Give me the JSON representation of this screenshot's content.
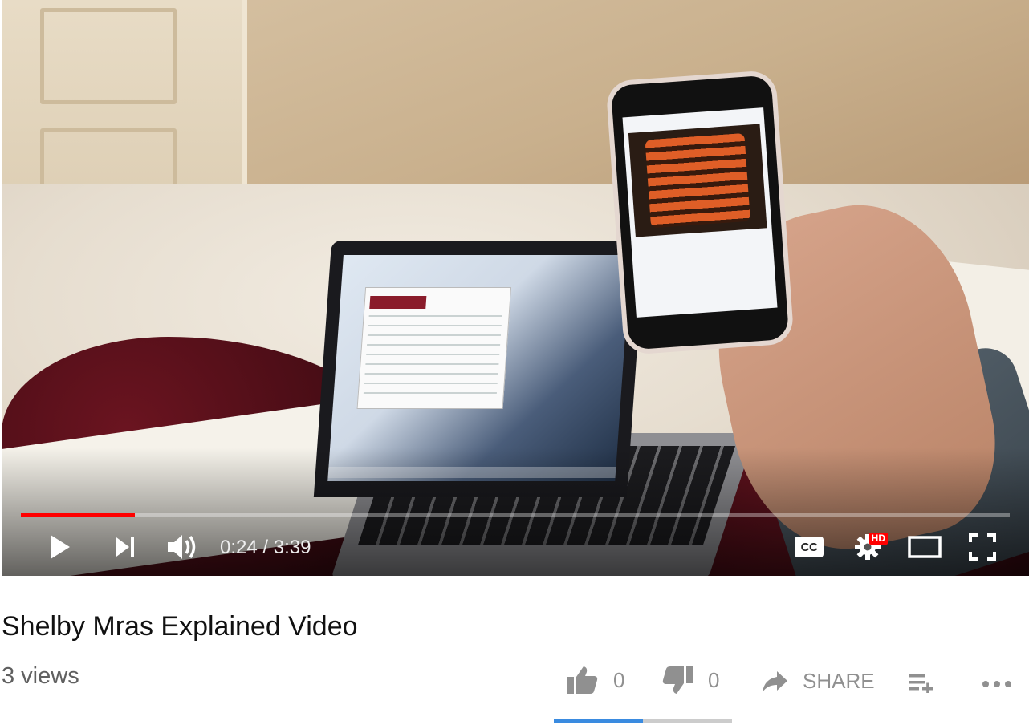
{
  "video": {
    "time_current": "0:24",
    "time_separator": " / ",
    "time_total": "3:39",
    "progress_played_fraction": 0.115,
    "progress_loaded_fraction": 0.115,
    "hd_badge": "HD",
    "cc_label": "CC"
  },
  "meta": {
    "title": "Shelby Mras Explained Video",
    "views": "3 views"
  },
  "actions": {
    "like_count": "0",
    "dislike_count": "0",
    "share_label": "SHARE",
    "like_fraction": 0.5
  },
  "colors": {
    "progress": "#ff0000",
    "like_bar": "#3a8be0",
    "action_gray": "#909090"
  },
  "icons": [
    "play-icon",
    "next-icon",
    "volume-icon",
    "cc-icon",
    "settings-icon",
    "theater-icon",
    "fullscreen-icon",
    "thumbs-up-icon",
    "thumbs-down-icon",
    "share-icon",
    "add-to-playlist-icon",
    "more-icon"
  ]
}
